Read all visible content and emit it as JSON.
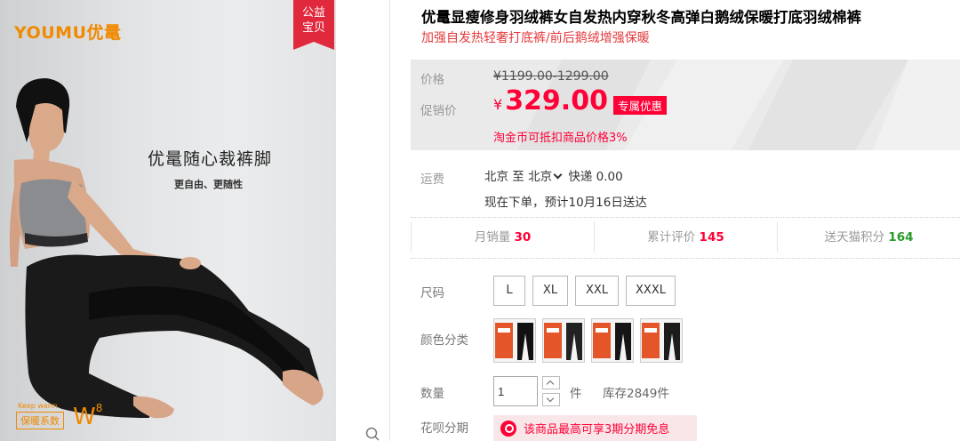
{
  "image": {
    "logo": "YOUMU优鼌",
    "charity_badge_line1": "公益",
    "charity_badge_line2": "宝贝",
    "slogan": "优鼌随心裁裤脚",
    "slogan_sub": "更自由、更随性",
    "keep_warm": "Keep warm",
    "warm_badge": "保暖系数",
    "warm_level": "W",
    "warm_level_num": "8"
  },
  "product": {
    "title": "优鼌显瘦修身羽绒裤女自发热内穿秋冬高弹白鹅绒保暖打底羽绒棉裤",
    "subtitle": "加强自发热轻奢打底裤/前后鹅绒增强保暖"
  },
  "price": {
    "original_label": "价格",
    "original_value": "¥1199.00-1299.00",
    "promo_label": "促销价",
    "currency": "¥",
    "promo_value": "329.00",
    "promo_tag": "专属优惠",
    "coin_text": "淘金币可抵扣商品价格3%"
  },
  "shipping": {
    "label": "运费",
    "from": "北京",
    "to_word": "至",
    "to": "北京",
    "method": "快递 0.00",
    "estimate": "现在下单，预计10月16日送达"
  },
  "stats": {
    "monthly_sales_label": "月销量",
    "monthly_sales_value": "30",
    "reviews_label": "累计评价",
    "reviews_value": "145",
    "points_label": "送天猫积分",
    "points_value": "164"
  },
  "options": {
    "size_label": "尺码",
    "sizes": [
      "L",
      "XL",
      "XXL",
      "XXXL"
    ],
    "color_label": "颜色分类"
  },
  "quantity": {
    "label": "数量",
    "value": "1",
    "unit": "件",
    "stock": "库存2849件"
  },
  "installment": {
    "label": "花呗分期",
    "text": "该商品最高可享3期分期免息"
  },
  "colors": {
    "brand_orange": "#f08a00",
    "price_red": "#ff0036",
    "points_green": "#2b9b2b"
  }
}
